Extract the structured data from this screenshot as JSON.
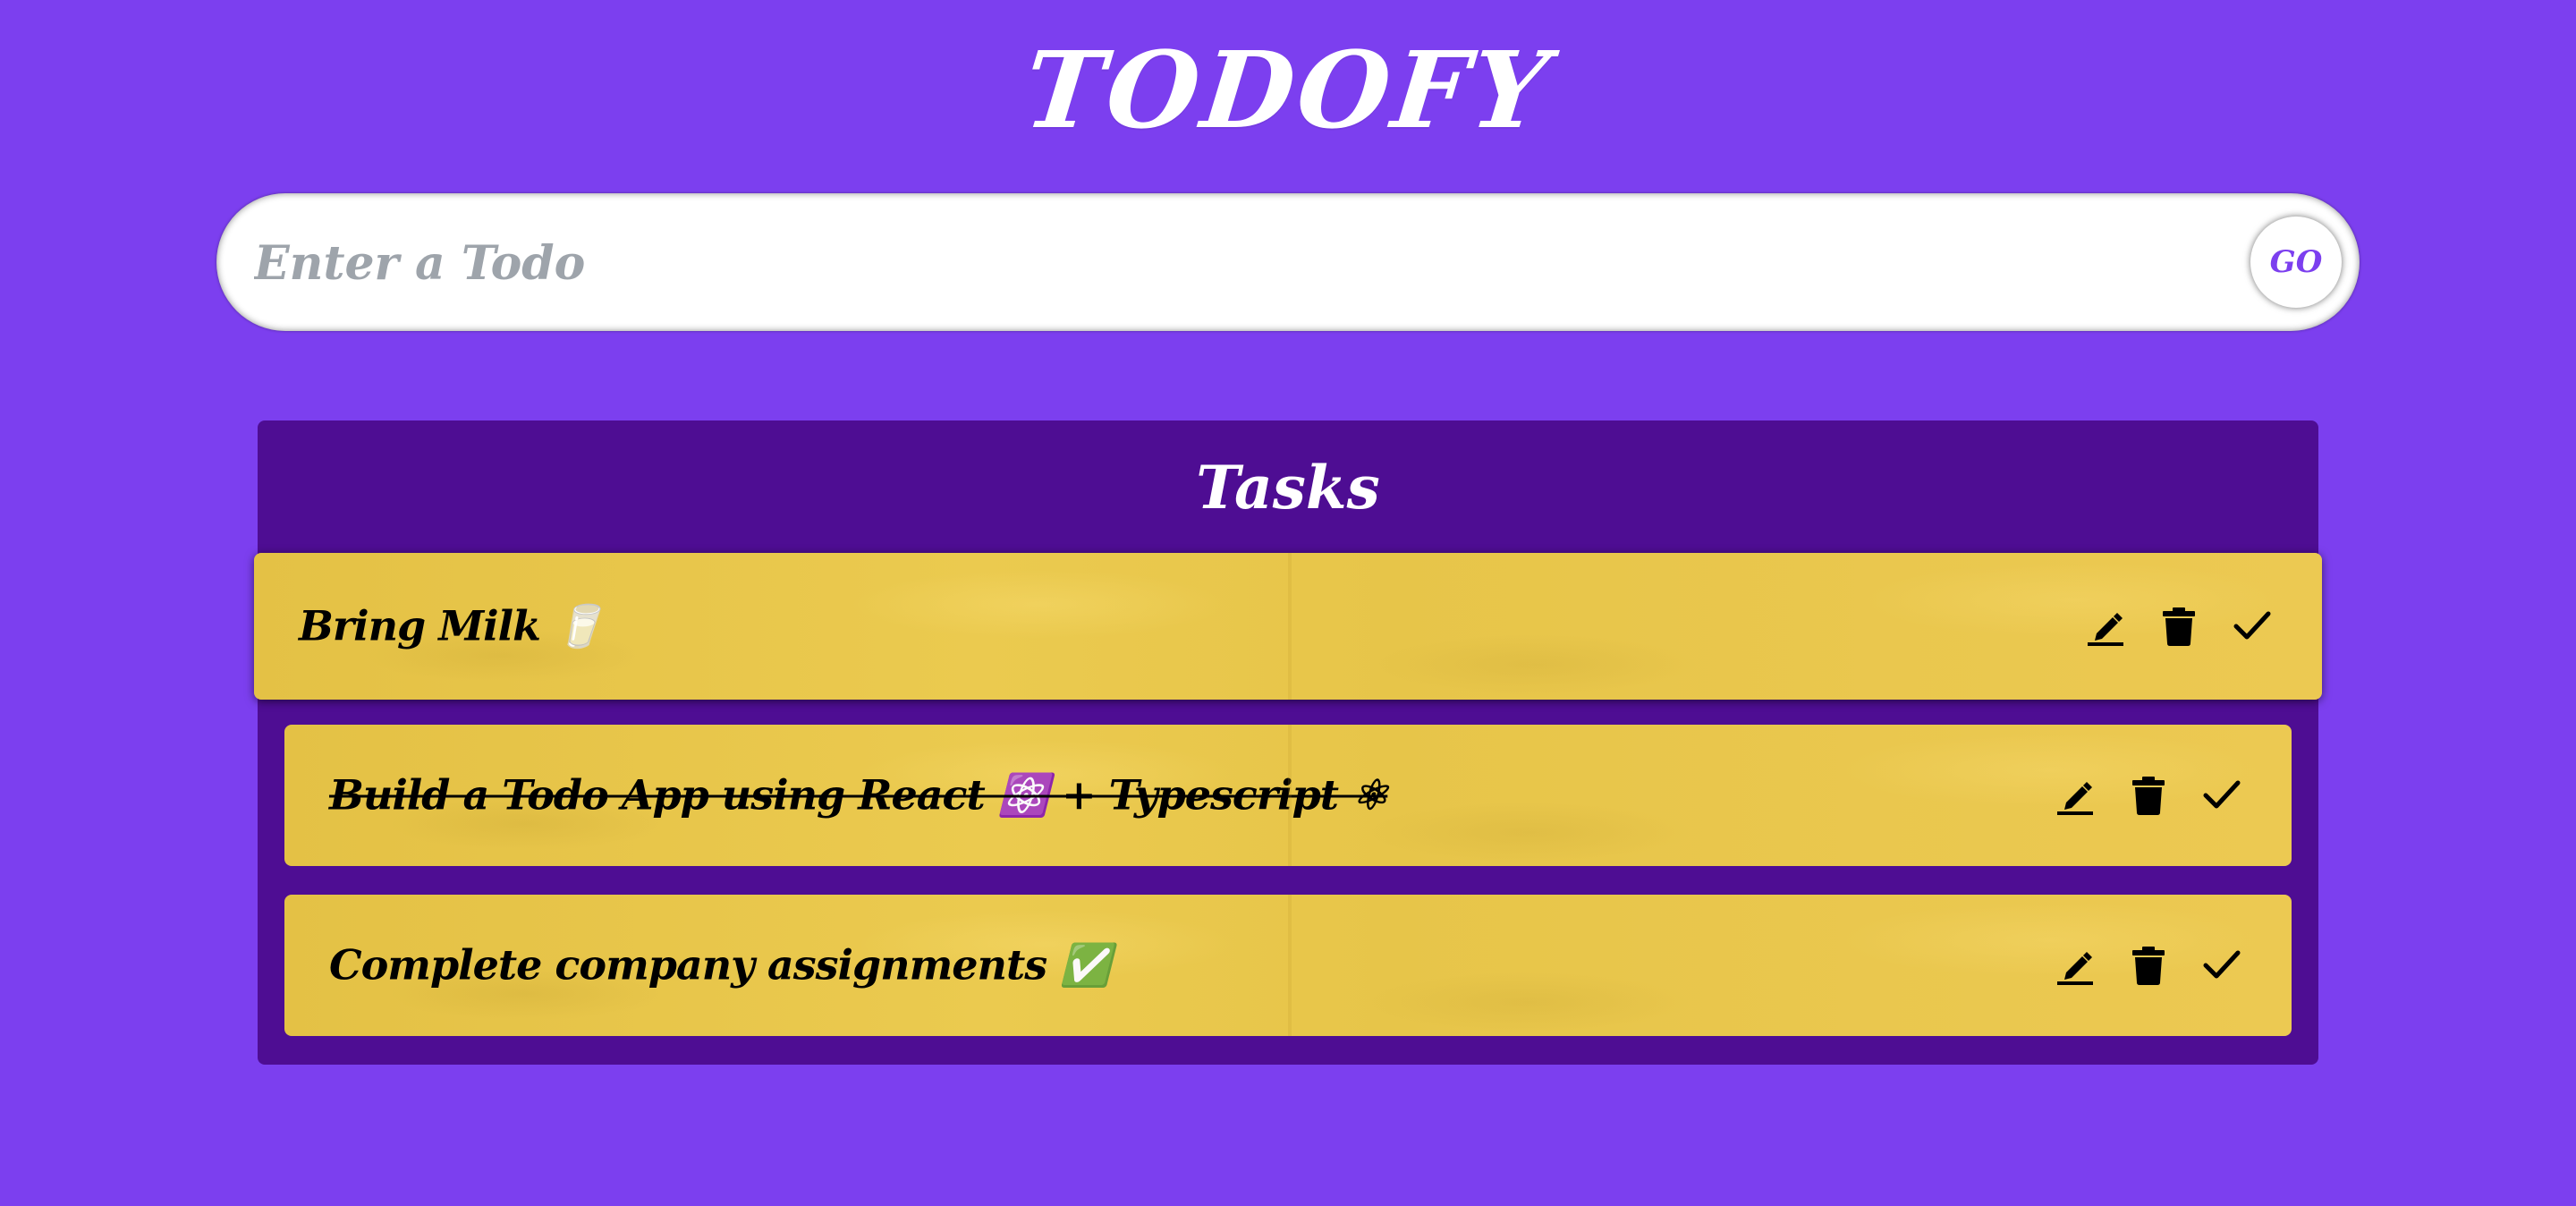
{
  "app": {
    "title": "TODOFY"
  },
  "input": {
    "placeholder": "Enter a Todo",
    "value": "",
    "go_label": "GO"
  },
  "tasks": {
    "heading": "Tasks",
    "items": [
      {
        "text": "Bring Milk 🥛",
        "completed": false,
        "active": true
      },
      {
        "text": "Build a Todo App using React ⚛️ + Typescript ⚛",
        "completed": true,
        "active": false
      },
      {
        "text": "Complete company assignments ✅",
        "completed": false,
        "active": false
      }
    ]
  },
  "icons": {
    "edit": "pencil-icon",
    "delete": "trash-icon",
    "done": "check-icon"
  },
  "colors": {
    "background": "#7c3fef",
    "panel": "#4e0d93",
    "card": "#e9c64b",
    "accent": "#7c3fef",
    "text": "#000000"
  }
}
